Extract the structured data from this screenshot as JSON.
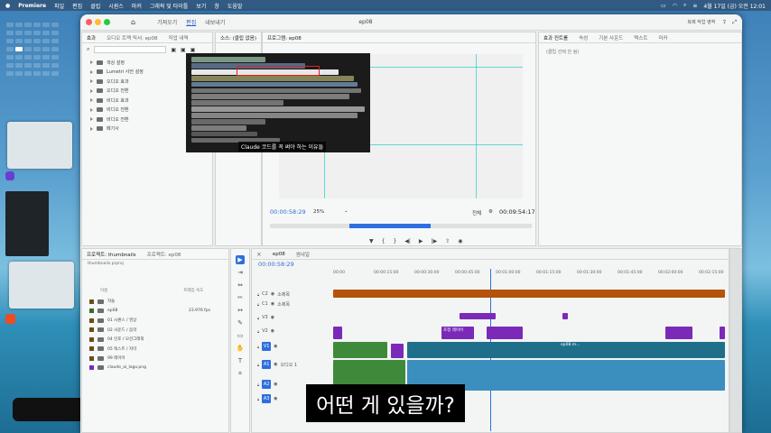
{
  "menubar": {
    "app": "Premiere",
    "items": [
      "파일",
      "편집",
      "클립",
      "시퀀스",
      "마커",
      "그래픽 및 타이틀",
      "보기",
      "창",
      "도움말"
    ],
    "clock": "4월 17일 (금) 오전 12:01"
  },
  "window": {
    "title": "ep08",
    "tabs": [
      "기져오기",
      "편집",
      "내보내기"
    ],
    "active_tab": "편집",
    "workspace_label": "복제 작업 영역"
  },
  "project_panel": {
    "tabs": [
      "효과",
      "오디오 트랙 믹서: ep08",
      "작업 내역"
    ],
    "folders": [
      "색상 설정",
      "Lumetri 사전 설정",
      "오디오 효과",
      "오디오 전환",
      "비디오 효과",
      "비디오 전환",
      "비디오 전환",
      "페기사"
    ]
  },
  "source_monitor": {
    "tab": "소스: (클립 없음)"
  },
  "program_monitor": {
    "tab": "프로그램: ep08",
    "timecode": "00:00:58:29",
    "zoom": "25%",
    "quality": "전체",
    "duration": "00:09:54:17",
    "subtitle": "Claude 코드를 꼭 써야 하는 이유들"
  },
  "effects_panel": {
    "tabs": [
      "효과 컨트롤",
      "속성",
      "기본 사운드",
      "텍스트",
      "마커"
    ],
    "empty": "(클립 선택 안 됨)"
  },
  "bin_panel": {
    "tabs": [
      "프로젝트: thumbnails",
      "프로젝트: ep08"
    ],
    "project_file": "thumbnails.prproj",
    "header_name": "이름",
    "header_rate": "프레임 속도",
    "items": [
      {
        "name": "자들",
        "rate": ""
      },
      {
        "name": "ep08",
        "rate": "23.976 fps"
      },
      {
        "name": "01 시퀀스 / 영상",
        "rate": ""
      },
      {
        "name": "02 사운드 / 음악",
        "rate": ""
      },
      {
        "name": "04 인포 / 모션그래픽",
        "rate": ""
      },
      {
        "name": "05 텍스트 / 자막",
        "rate": ""
      },
      {
        "name": "99 레이어",
        "rate": ""
      },
      {
        "name": "claude_ai_logo.png",
        "rate": ""
      }
    ]
  },
  "timeline": {
    "tabs": [
      "ep08",
      "썸네일"
    ],
    "timecode": "00:00:58:29",
    "ruler": [
      "00:00",
      "00:00:15:00",
      "00:00:30:00",
      "00:00:45:00",
      "00:01:00:00",
      "00:01:15:00",
      "00:01:30:00",
      "00:01:45:00",
      "00:02:00:00",
      "00:02:15:00"
    ],
    "tracks": [
      {
        "name": "C2",
        "label": "소제목"
      },
      {
        "name": "C1",
        "label": "소제목"
      },
      {
        "name": "V3",
        "label": ""
      },
      {
        "name": "V2",
        "label": ""
      },
      {
        "name": "V1",
        "label": ""
      },
      {
        "name": "A1",
        "label": "오디오 1"
      },
      {
        "name": "A2",
        "label": ""
      },
      {
        "name": "A3",
        "label": ""
      }
    ],
    "clip_labels": [
      "조정 레이어",
      "ep08.m..."
    ]
  },
  "caption": "어떤 게 있을까?",
  "colors": {
    "accent": "#2d6fe0",
    "subtitle_track": "#b45309",
    "adjust_clip": "#7b2ab8",
    "video_clip": "#1f6f8b",
    "audio_clip": "#3f8a3a"
  }
}
